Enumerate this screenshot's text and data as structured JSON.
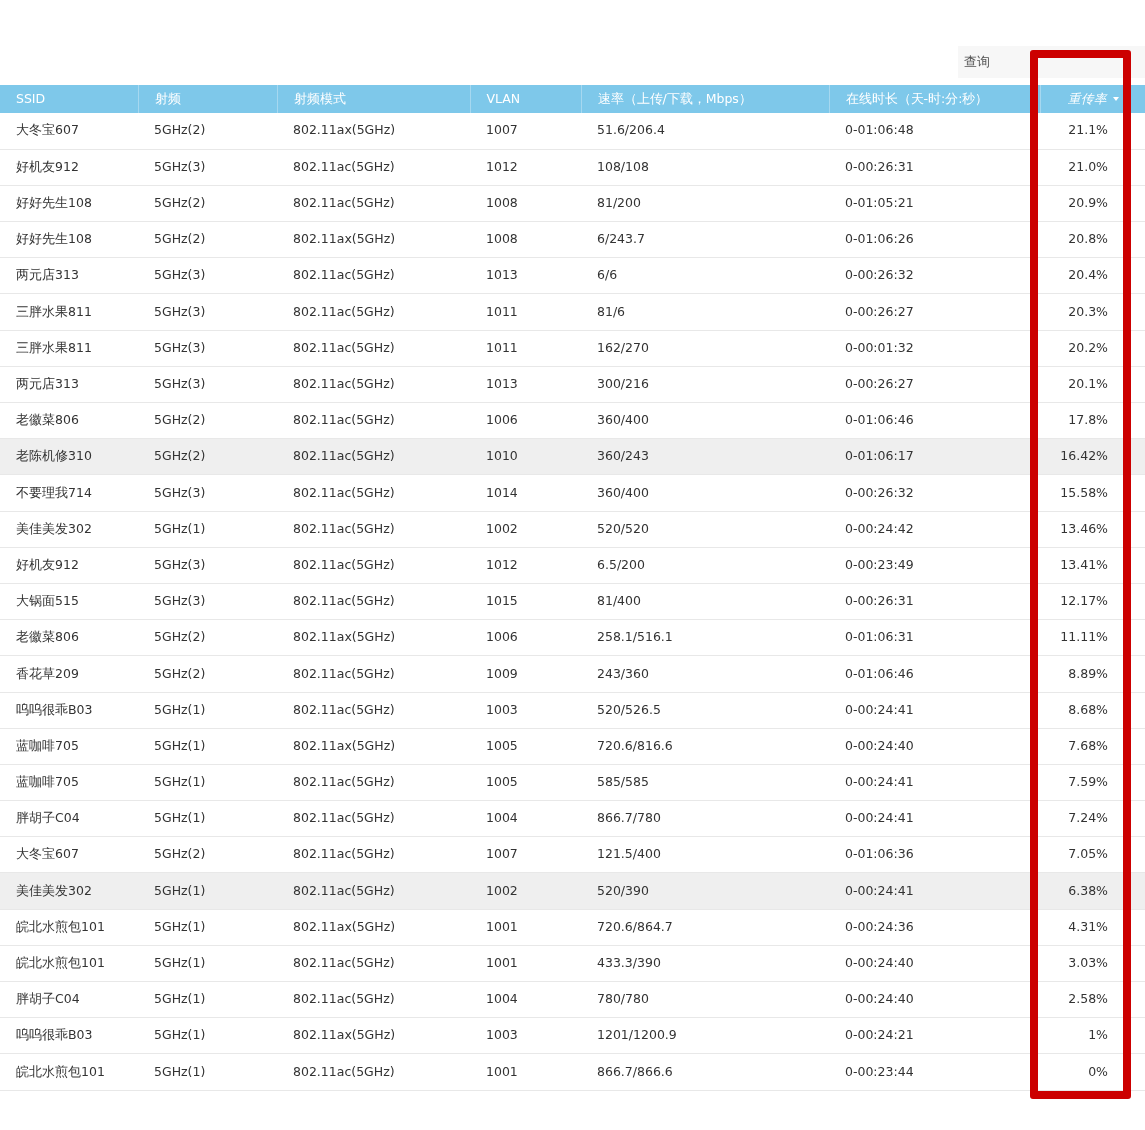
{
  "search": {
    "placeholder": "查询"
  },
  "table": {
    "columns": [
      {
        "label": "SSID",
        "sorted": false
      },
      {
        "label": "射频",
        "sorted": false
      },
      {
        "label": "射频模式",
        "sorted": false
      },
      {
        "label": "VLAN",
        "sorted": false
      },
      {
        "label": "速率（上传/下载，Mbps）",
        "sorted": false
      },
      {
        "label": "在线时长（天-时:分:秒）",
        "sorted": false
      },
      {
        "label": "重传率",
        "sorted": true
      }
    ],
    "rows": [
      {
        "cells": [
          "大冬宝607",
          "5GHz(2)",
          "802.11ax(5GHz)",
          "1007",
          "51.6/206.4",
          "0-01:06:48",
          "21.1%"
        ],
        "highlighted": false
      },
      {
        "cells": [
          "好机友912",
          "5GHz(3)",
          "802.11ac(5GHz)",
          "1012",
          "108/108",
          "0-00:26:31",
          "21.0%"
        ],
        "highlighted": false
      },
      {
        "cells": [
          "好好先生108",
          "5GHz(2)",
          "802.11ac(5GHz)",
          "1008",
          "81/200",
          "0-01:05:21",
          "20.9%"
        ],
        "highlighted": false
      },
      {
        "cells": [
          "好好先生108",
          "5GHz(2)",
          "802.11ax(5GHz)",
          "1008",
          "6/243.7",
          "0-01:06:26",
          "20.8%"
        ],
        "highlighted": false
      },
      {
        "cells": [
          "两元店313",
          "5GHz(3)",
          "802.11ac(5GHz)",
          "1013",
          "6/6",
          "0-00:26:32",
          "20.4%"
        ],
        "highlighted": false
      },
      {
        "cells": [
          "三胖水果811",
          "5GHz(3)",
          "802.11ac(5GHz)",
          "1011",
          "81/6",
          "0-00:26:27",
          "20.3%"
        ],
        "highlighted": false
      },
      {
        "cells": [
          "三胖水果811",
          "5GHz(3)",
          "802.11ac(5GHz)",
          "1011",
          "162/270",
          "0-00:01:32",
          "20.2%"
        ],
        "highlighted": false
      },
      {
        "cells": [
          "两元店313",
          "5GHz(3)",
          "802.11ac(5GHz)",
          "1013",
          "300/216",
          "0-00:26:27",
          "20.1%"
        ],
        "highlighted": false
      },
      {
        "cells": [
          "老徽菜806",
          "5GHz(2)",
          "802.11ac(5GHz)",
          "1006",
          "360/400",
          "0-01:06:46",
          "17.8%"
        ],
        "highlighted": false
      },
      {
        "cells": [
          "老陈机修310",
          "5GHz(2)",
          "802.11ac(5GHz)",
          "1010",
          "360/243",
          "0-01:06:17",
          "16.42%"
        ],
        "highlighted": true
      },
      {
        "cells": [
          "不要理我714",
          "5GHz(3)",
          "802.11ac(5GHz)",
          "1014",
          "360/400",
          "0-00:26:32",
          "15.58%"
        ],
        "highlighted": false
      },
      {
        "cells": [
          "美佳美发302",
          "5GHz(1)",
          "802.11ac(5GHz)",
          "1002",
          "520/520",
          "0-00:24:42",
          "13.46%"
        ],
        "highlighted": false
      },
      {
        "cells": [
          "好机友912",
          "5GHz(3)",
          "802.11ac(5GHz)",
          "1012",
          "6.5/200",
          "0-00:23:49",
          "13.41%"
        ],
        "highlighted": false
      },
      {
        "cells": [
          "大锅面515",
          "5GHz(3)",
          "802.11ac(5GHz)",
          "1015",
          "81/400",
          "0-00:26:31",
          "12.17%"
        ],
        "highlighted": false
      },
      {
        "cells": [
          "老徽菜806",
          "5GHz(2)",
          "802.11ax(5GHz)",
          "1006",
          "258.1/516.1",
          "0-01:06:31",
          "11.11%"
        ],
        "highlighted": false
      },
      {
        "cells": [
          "香花草209",
          "5GHz(2)",
          "802.11ac(5GHz)",
          "1009",
          "243/360",
          "0-01:06:46",
          "8.89%"
        ],
        "highlighted": false
      },
      {
        "cells": [
          "呜呜很乖B03",
          "5GHz(1)",
          "802.11ac(5GHz)",
          "1003",
          "520/526.5",
          "0-00:24:41",
          "8.68%"
        ],
        "highlighted": false
      },
      {
        "cells": [
          "蓝咖啡705",
          "5GHz(1)",
          "802.11ax(5GHz)",
          "1005",
          "720.6/816.6",
          "0-00:24:40",
          "7.68%"
        ],
        "highlighted": false
      },
      {
        "cells": [
          "蓝咖啡705",
          "5GHz(1)",
          "802.11ac(5GHz)",
          "1005",
          "585/585",
          "0-00:24:41",
          "7.59%"
        ],
        "highlighted": false
      },
      {
        "cells": [
          "胖胡子C04",
          "5GHz(1)",
          "802.11ac(5GHz)",
          "1004",
          "866.7/780",
          "0-00:24:41",
          "7.24%"
        ],
        "highlighted": false
      },
      {
        "cells": [
          "大冬宝607",
          "5GHz(2)",
          "802.11ac(5GHz)",
          "1007",
          "121.5/400",
          "0-01:06:36",
          "7.05%"
        ],
        "highlighted": false
      },
      {
        "cells": [
          "美佳美发302",
          "5GHz(1)",
          "802.11ac(5GHz)",
          "1002",
          "520/390",
          "0-00:24:41",
          "6.38%"
        ],
        "highlighted": true
      },
      {
        "cells": [
          "皖北水煎包101",
          "5GHz(1)",
          "802.11ax(5GHz)",
          "1001",
          "720.6/864.7",
          "0-00:24:36",
          "4.31%"
        ],
        "highlighted": false
      },
      {
        "cells": [
          "皖北水煎包101",
          "5GHz(1)",
          "802.11ac(5GHz)",
          "1001",
          "433.3/390",
          "0-00:24:40",
          "3.03%"
        ],
        "highlighted": false
      },
      {
        "cells": [
          "胖胡子C04",
          "5GHz(1)",
          "802.11ac(5GHz)",
          "1004",
          "780/780",
          "0-00:24:40",
          "2.58%"
        ],
        "highlighted": false
      },
      {
        "cells": [
          "呜呜很乖B03",
          "5GHz(1)",
          "802.11ax(5GHz)",
          "1003",
          "1201/1200.9",
          "0-00:24:21",
          "1%"
        ],
        "highlighted": false
      },
      {
        "cells": [
          "皖北水煎包101",
          "5GHz(1)",
          "802.11ac(5GHz)",
          "1001",
          "866.7/866.6",
          "0-00:23:44",
          "0%"
        ],
        "highlighted": false
      }
    ]
  },
  "annotations": [
    {
      "kind": "frame"
    }
  ]
}
